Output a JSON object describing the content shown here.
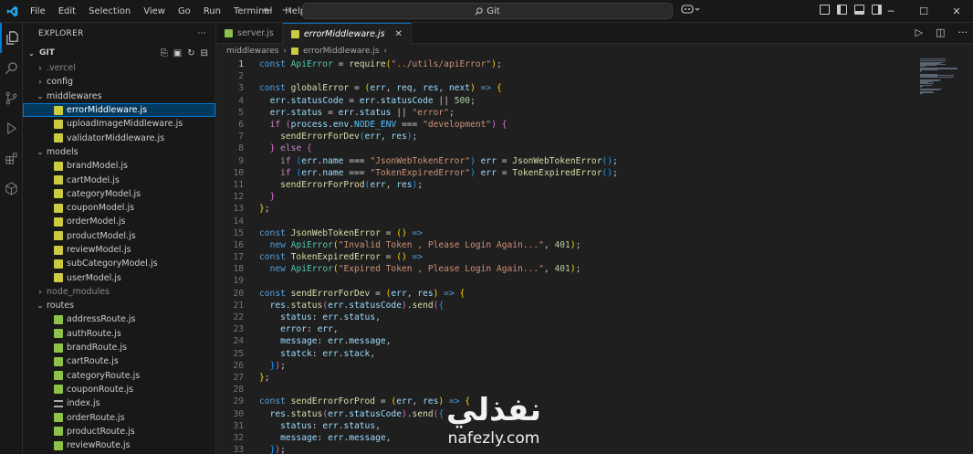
{
  "menu": [
    "File",
    "Edit",
    "Selection",
    "View",
    "Go",
    "Run",
    "Terminal",
    "Help"
  ],
  "command_center": {
    "text": "Git"
  },
  "explorer": {
    "title": "EXPLORER",
    "section": "GIT",
    "tree": [
      {
        "label": ".vercel",
        "kind": "folder",
        "open": false,
        "depth": 1,
        "dim": true
      },
      {
        "label": "config",
        "kind": "folder",
        "open": false,
        "depth": 1
      },
      {
        "label": "middlewares",
        "kind": "folder",
        "open": true,
        "depth": 1
      },
      {
        "label": "errorMiddleware.js",
        "kind": "js",
        "depth": 2,
        "selected": true
      },
      {
        "label": "uploadImageMiddleware.js",
        "kind": "js",
        "depth": 2
      },
      {
        "label": "validatorMiddleware.js",
        "kind": "js",
        "depth": 2
      },
      {
        "label": "models",
        "kind": "folder",
        "open": true,
        "depth": 1
      },
      {
        "label": "brandModel.js",
        "kind": "js",
        "depth": 2
      },
      {
        "label": "cartModel.js",
        "kind": "js",
        "depth": 2
      },
      {
        "label": "categoryModel.js",
        "kind": "js",
        "depth": 2
      },
      {
        "label": "couponModel.js",
        "kind": "js",
        "depth": 2
      },
      {
        "label": "orderModel.js",
        "kind": "js",
        "depth": 2
      },
      {
        "label": "productModel.js",
        "kind": "js",
        "depth": 2
      },
      {
        "label": "reviewModel.js",
        "kind": "js",
        "depth": 2
      },
      {
        "label": "subCategoryModel.js",
        "kind": "js",
        "depth": 2
      },
      {
        "label": "userModel.js",
        "kind": "js",
        "depth": 2
      },
      {
        "label": "node_modules",
        "kind": "folder",
        "open": false,
        "depth": 1,
        "dim": true
      },
      {
        "label": "routes",
        "kind": "folder",
        "open": true,
        "depth": 1
      },
      {
        "label": "addressRoute.js",
        "kind": "jsr",
        "depth": 2
      },
      {
        "label": "authRoute.js",
        "kind": "jsr",
        "depth": 2
      },
      {
        "label": "brandRoute.js",
        "kind": "jsr",
        "depth": 2
      },
      {
        "label": "cartRoute.js",
        "kind": "jsr",
        "depth": 2
      },
      {
        "label": "categoryRoute.js",
        "kind": "jsr",
        "depth": 2
      },
      {
        "label": "couponRoute.js",
        "kind": "jsr",
        "depth": 2
      },
      {
        "label": "index.js",
        "kind": "idx",
        "depth": 2
      },
      {
        "label": "orderRoute.js",
        "kind": "jsr",
        "depth": 2
      },
      {
        "label": "productRoute.js",
        "kind": "jsr",
        "depth": 2
      },
      {
        "label": "reviewRoute.js",
        "kind": "jsr",
        "depth": 2
      }
    ]
  },
  "tabs": [
    {
      "label": "server.js",
      "active": false,
      "icon": "green"
    },
    {
      "label": "errorMiddleware.js",
      "active": true,
      "icon": "yellow"
    }
  ],
  "breadcrumb": {
    "folder": "middlewares",
    "file": "errorMiddleware.js"
  },
  "code": [
    [
      [
        "kw",
        "const "
      ],
      [
        "cls",
        "ApiError"
      ],
      [
        "pun",
        " = "
      ],
      [
        "fn",
        "require"
      ],
      [
        "br1",
        "("
      ],
      [
        "str",
        "\"../utils/apiError\""
      ],
      [
        "br1",
        ")"
      ],
      [
        "pun",
        ";"
      ]
    ],
    [],
    [
      [
        "kw",
        "const "
      ],
      [
        "fn",
        "globalError"
      ],
      [
        "pun",
        " = "
      ],
      [
        "br1",
        "("
      ],
      [
        "var",
        "err"
      ],
      [
        "pun",
        ", "
      ],
      [
        "var",
        "req"
      ],
      [
        "pun",
        ", "
      ],
      [
        "var",
        "res"
      ],
      [
        "pun",
        ", "
      ],
      [
        "var",
        "next"
      ],
      [
        "br1",
        ")"
      ],
      [
        "kw",
        " => "
      ],
      [
        "br1",
        "{"
      ]
    ],
    [
      [
        "pun",
        "  "
      ],
      [
        "var",
        "err"
      ],
      [
        "pun",
        "."
      ],
      [
        "var",
        "statusCode"
      ],
      [
        "pun",
        " = "
      ],
      [
        "var",
        "err"
      ],
      [
        "pun",
        "."
      ],
      [
        "var",
        "statusCode"
      ],
      [
        "pun",
        " || "
      ],
      [
        "num",
        "500"
      ],
      [
        "pun",
        ";"
      ]
    ],
    [
      [
        "pun",
        "  "
      ],
      [
        "var",
        "err"
      ],
      [
        "pun",
        "."
      ],
      [
        "var",
        "status"
      ],
      [
        "pun",
        " = "
      ],
      [
        "var",
        "err"
      ],
      [
        "pun",
        "."
      ],
      [
        "var",
        "status"
      ],
      [
        "pun",
        " || "
      ],
      [
        "str",
        "\"error\""
      ],
      [
        "pun",
        ";"
      ]
    ],
    [
      [
        "pun",
        "  "
      ],
      [
        "kw2",
        "if "
      ],
      [
        "br2",
        "("
      ],
      [
        "var",
        "process"
      ],
      [
        "pun",
        "."
      ],
      [
        "var",
        "env"
      ],
      [
        "pun",
        "."
      ],
      [
        "const",
        "NODE_ENV"
      ],
      [
        "pun",
        " === "
      ],
      [
        "str",
        "\"development\""
      ],
      [
        "br2",
        ")"
      ],
      [
        "pun",
        " "
      ],
      [
        "br2",
        "{"
      ]
    ],
    [
      [
        "pun",
        "    "
      ],
      [
        "fn",
        "sendErrorForDev"
      ],
      [
        "br3",
        "("
      ],
      [
        "var",
        "err"
      ],
      [
        "pun",
        ", "
      ],
      [
        "var",
        "res"
      ],
      [
        "br3",
        ")"
      ],
      [
        "pun",
        ";"
      ]
    ],
    [
      [
        "pun",
        "  "
      ],
      [
        "br2",
        "}"
      ],
      [
        "kw2",
        " else "
      ],
      [
        "br2",
        "{"
      ]
    ],
    [
      [
        "pun",
        "    "
      ],
      [
        "kw2",
        "if "
      ],
      [
        "br3",
        "("
      ],
      [
        "var",
        "err"
      ],
      [
        "pun",
        "."
      ],
      [
        "var",
        "name"
      ],
      [
        "pun",
        " === "
      ],
      [
        "str",
        "\"JsonWebTokenError\""
      ],
      [
        "br3",
        ")"
      ],
      [
        "pun",
        " "
      ],
      [
        "var",
        "err"
      ],
      [
        "pun",
        " = "
      ],
      [
        "fn",
        "JsonWebTokenError"
      ],
      [
        "br3",
        "()"
      ],
      [
        "pun",
        ";"
      ]
    ],
    [
      [
        "pun",
        "    "
      ],
      [
        "kw2",
        "if "
      ],
      [
        "br3",
        "("
      ],
      [
        "var",
        "err"
      ],
      [
        "pun",
        "."
      ],
      [
        "var",
        "name"
      ],
      [
        "pun",
        " === "
      ],
      [
        "str",
        "\"TokenExpiredError\""
      ],
      [
        "br3",
        ")"
      ],
      [
        "pun",
        " "
      ],
      [
        "var",
        "err"
      ],
      [
        "pun",
        " = "
      ],
      [
        "fn",
        "TokenExpiredError"
      ],
      [
        "br3",
        "()"
      ],
      [
        "pun",
        ";"
      ]
    ],
    [
      [
        "pun",
        "    "
      ],
      [
        "fn",
        "sendErrorForProd"
      ],
      [
        "br3",
        "("
      ],
      [
        "var",
        "err"
      ],
      [
        "pun",
        ", "
      ],
      [
        "var",
        "res"
      ],
      [
        "br3",
        ")"
      ],
      [
        "pun",
        ";"
      ]
    ],
    [
      [
        "pun",
        "  "
      ],
      [
        "br2",
        "}"
      ]
    ],
    [
      [
        "br1",
        "}"
      ],
      [
        "pun",
        ";"
      ]
    ],
    [],
    [
      [
        "kw",
        "const "
      ],
      [
        "fn",
        "JsonWebTokenError"
      ],
      [
        "pun",
        " = "
      ],
      [
        "br1",
        "()"
      ],
      [
        "kw",
        " =>"
      ]
    ],
    [
      [
        "pun",
        "  "
      ],
      [
        "kw",
        "new "
      ],
      [
        "cls",
        "ApiError"
      ],
      [
        "br1",
        "("
      ],
      [
        "str",
        "\"Invalid Token , Please Login Again...\""
      ],
      [
        "pun",
        ", "
      ],
      [
        "num",
        "401"
      ],
      [
        "br1",
        ")"
      ],
      [
        "pun",
        ";"
      ]
    ],
    [
      [
        "kw",
        "const "
      ],
      [
        "fn",
        "TokenExpiredError"
      ],
      [
        "pun",
        " = "
      ],
      [
        "br1",
        "()"
      ],
      [
        "kw",
        " =>"
      ]
    ],
    [
      [
        "pun",
        "  "
      ],
      [
        "kw",
        "new "
      ],
      [
        "cls",
        "ApiError"
      ],
      [
        "br1",
        "("
      ],
      [
        "str",
        "\"Expired Token , Please Login Again...\""
      ],
      [
        "pun",
        ", "
      ],
      [
        "num",
        "401"
      ],
      [
        "br1",
        ")"
      ],
      [
        "pun",
        ";"
      ]
    ],
    [],
    [
      [
        "kw",
        "const "
      ],
      [
        "fn",
        "sendErrorForDev"
      ],
      [
        "pun",
        " = "
      ],
      [
        "br1",
        "("
      ],
      [
        "var",
        "err"
      ],
      [
        "pun",
        ", "
      ],
      [
        "var",
        "res"
      ],
      [
        "br1",
        ")"
      ],
      [
        "kw",
        " => "
      ],
      [
        "br1",
        "{"
      ]
    ],
    [
      [
        "pun",
        "  "
      ],
      [
        "var",
        "res"
      ],
      [
        "pun",
        "."
      ],
      [
        "fn",
        "status"
      ],
      [
        "br2",
        "("
      ],
      [
        "var",
        "err"
      ],
      [
        "pun",
        "."
      ],
      [
        "var",
        "statusCode"
      ],
      [
        "br2",
        ")"
      ],
      [
        "pun",
        "."
      ],
      [
        "fn",
        "send"
      ],
      [
        "br2",
        "("
      ],
      [
        "br3",
        "{"
      ]
    ],
    [
      [
        "pun",
        "    "
      ],
      [
        "var",
        "status"
      ],
      [
        "pun",
        ": "
      ],
      [
        "var",
        "err"
      ],
      [
        "pun",
        "."
      ],
      [
        "var",
        "status"
      ],
      [
        "pun",
        ","
      ]
    ],
    [
      [
        "pun",
        "    "
      ],
      [
        "var",
        "error"
      ],
      [
        "pun",
        ": "
      ],
      [
        "var",
        "err"
      ],
      [
        "pun",
        ","
      ]
    ],
    [
      [
        "pun",
        "    "
      ],
      [
        "var",
        "message"
      ],
      [
        "pun",
        ": "
      ],
      [
        "var",
        "err"
      ],
      [
        "pun",
        "."
      ],
      [
        "var",
        "message"
      ],
      [
        "pun",
        ","
      ]
    ],
    [
      [
        "pun",
        "    "
      ],
      [
        "var",
        "statck"
      ],
      [
        "pun",
        ": "
      ],
      [
        "var",
        "err"
      ],
      [
        "pun",
        "."
      ],
      [
        "var",
        "stack"
      ],
      [
        "pun",
        ","
      ]
    ],
    [
      [
        "pun",
        "  "
      ],
      [
        "br3",
        "}"
      ],
      [
        "br2",
        ")"
      ],
      [
        "pun",
        ";"
      ]
    ],
    [
      [
        "br1",
        "}"
      ],
      [
        "pun",
        ";"
      ]
    ],
    [],
    [
      [
        "kw",
        "const "
      ],
      [
        "fn",
        "sendErrorForProd"
      ],
      [
        "pun",
        " = "
      ],
      [
        "br1",
        "("
      ],
      [
        "var",
        "err"
      ],
      [
        "pun",
        ", "
      ],
      [
        "var",
        "res"
      ],
      [
        "br1",
        ")"
      ],
      [
        "kw",
        " => "
      ],
      [
        "br1",
        "{"
      ]
    ],
    [
      [
        "pun",
        "  "
      ],
      [
        "var",
        "res"
      ],
      [
        "pun",
        "."
      ],
      [
        "fn",
        "status"
      ],
      [
        "br2",
        "("
      ],
      [
        "var",
        "err"
      ],
      [
        "pun",
        "."
      ],
      [
        "var",
        "statusCode"
      ],
      [
        "br2",
        ")"
      ],
      [
        "pun",
        "."
      ],
      [
        "fn",
        "send"
      ],
      [
        "br2",
        "("
      ],
      [
        "br3",
        "{"
      ]
    ],
    [
      [
        "pun",
        "    "
      ],
      [
        "var",
        "status"
      ],
      [
        "pun",
        ": "
      ],
      [
        "var",
        "err"
      ],
      [
        "pun",
        "."
      ],
      [
        "var",
        "status"
      ],
      [
        "pun",
        ","
      ]
    ],
    [
      [
        "pun",
        "    "
      ],
      [
        "var",
        "message"
      ],
      [
        "pun",
        ": "
      ],
      [
        "var",
        "err"
      ],
      [
        "pun",
        "."
      ],
      [
        "var",
        "message"
      ],
      [
        "pun",
        ","
      ]
    ],
    [
      [
        "pun",
        "  "
      ],
      [
        "br3",
        "}"
      ],
      [
        "br2",
        ")"
      ],
      [
        "pun",
        ";"
      ]
    ]
  ],
  "current_line": 1,
  "watermark": {
    "arabic": "نفذلي",
    "latin": "nafezly.com"
  }
}
